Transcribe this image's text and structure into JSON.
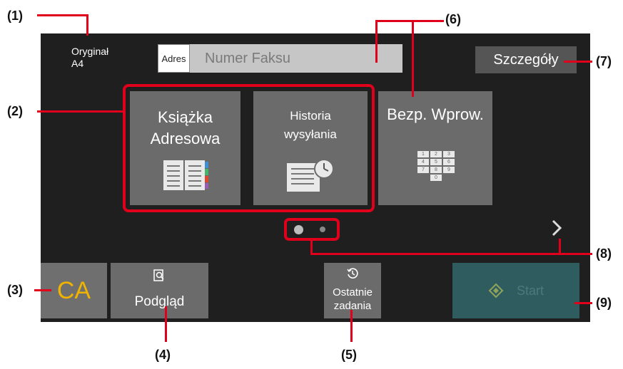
{
  "annotations": [
    "(1)",
    "(2)",
    "(3)",
    "(4)",
    "(5)",
    "(6)",
    "(7)",
    "(8)",
    "(9)"
  ],
  "original": {
    "label": "Oryginał",
    "size": "A4"
  },
  "address": {
    "label": "Adres",
    "placeholder": "Numer Faksu"
  },
  "details_label": "Szczegóły",
  "tiles": [
    {
      "line1": "Książka",
      "line2": "Adresowa",
      "icon": "address-book-icon"
    },
    {
      "line1": "Historia",
      "line2": "wysyłania",
      "icon": "send-history-icon"
    },
    {
      "line1": "Bezp. Wprow.",
      "line2": "",
      "icon": "keypad-icon"
    }
  ],
  "keypad_keys": [
    "1",
    "2",
    "3",
    "4",
    "5",
    "6",
    "7",
    "8",
    "9",
    "0"
  ],
  "page_indicator": {
    "pages": 2,
    "current": 1
  },
  "next_icon": "chevron-right-icon",
  "ca_label": "CA",
  "preview": {
    "label": "Podgląd",
    "icon": "preview-magnifier-icon"
  },
  "recent_jobs": {
    "line1": "Ostatnie",
    "line2": "zadania",
    "icon": "history-clock-icon"
  },
  "start_label": "Start",
  "colors": {
    "annotation": "#e0001b",
    "panel": "#1f1f1f",
    "tile": "#6b6b6b",
    "ca_text": "#f0b400",
    "start_bg": "#2f5c5f"
  }
}
